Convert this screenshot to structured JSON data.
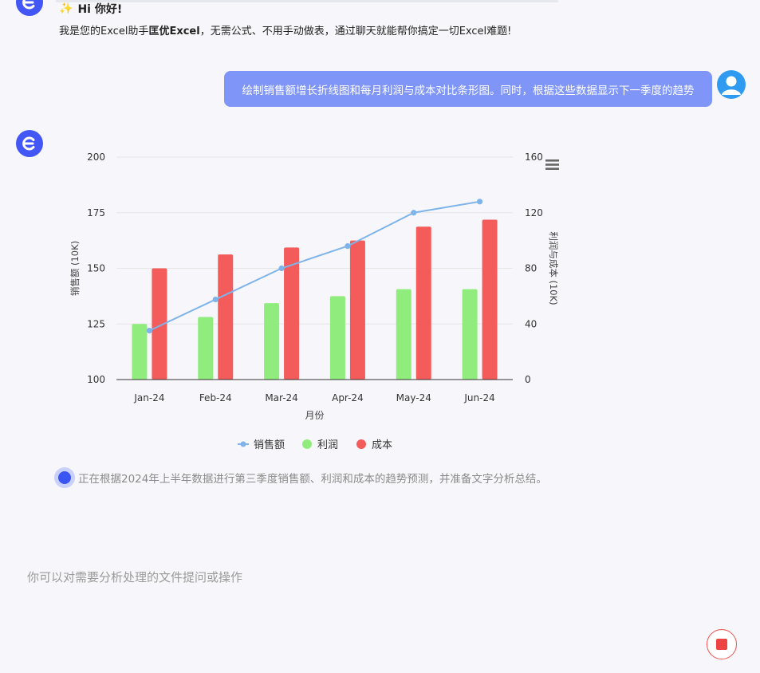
{
  "greeting": {
    "title": "Hi 你好!",
    "line_prefix": "我是您的Excel助手",
    "assistant_name": "匡优Excel",
    "line_suffix": "，无需公式、不用手动做表，通过聊天就能帮你搞定一切Excel难题!"
  },
  "bot_avatar_glyph": "Ɛ",
  "user_message": "绘制销售额增长折线图和每月利润与成本对比条形图。同时，根据这些数据显示下一季度的趋势",
  "chart_data": {
    "type": "bar",
    "categories": [
      "Jan-24",
      "Feb-24",
      "Mar-24",
      "Apr-24",
      "May-24",
      "Jun-24"
    ],
    "xlabel": "月份",
    "ylabel_left": "销售额 (10K)",
    "ylabel_right": "利润与成本 (10K)",
    "ylim_left": [
      100,
      200
    ],
    "ylim_right": [
      0,
      160
    ],
    "yticks_left": [
      100,
      125,
      150,
      175,
      200
    ],
    "yticks_right": [
      0,
      40,
      80,
      120,
      160
    ],
    "series": [
      {
        "name": "销售额",
        "type": "line",
        "axis": "left",
        "color": "#7eb4ea",
        "values": [
          122,
          136,
          150,
          160,
          175,
          180
        ]
      },
      {
        "name": "利润",
        "type": "bar",
        "axis": "right",
        "color": "#90ed7d",
        "values": [
          40,
          45,
          55,
          60,
          65,
          65
        ]
      },
      {
        "name": "成本",
        "type": "bar",
        "axis": "right",
        "color": "#f45b5b",
        "values": [
          80,
          90,
          95,
          100,
          110,
          115
        ]
      }
    ],
    "legend_position": "bottom-center",
    "grid": true
  },
  "status": {
    "text": "正在根据2024年上半年数据进行第三季度销售额、利润和成本的趋势预测，并准备文字分析总结。"
  },
  "input": {
    "placeholder": "你可以对需要分析处理的文件提问或操作"
  },
  "colors": {
    "accent": "#4257f5",
    "user_bubble": "#7f95f7",
    "stop": "#ef4444"
  }
}
